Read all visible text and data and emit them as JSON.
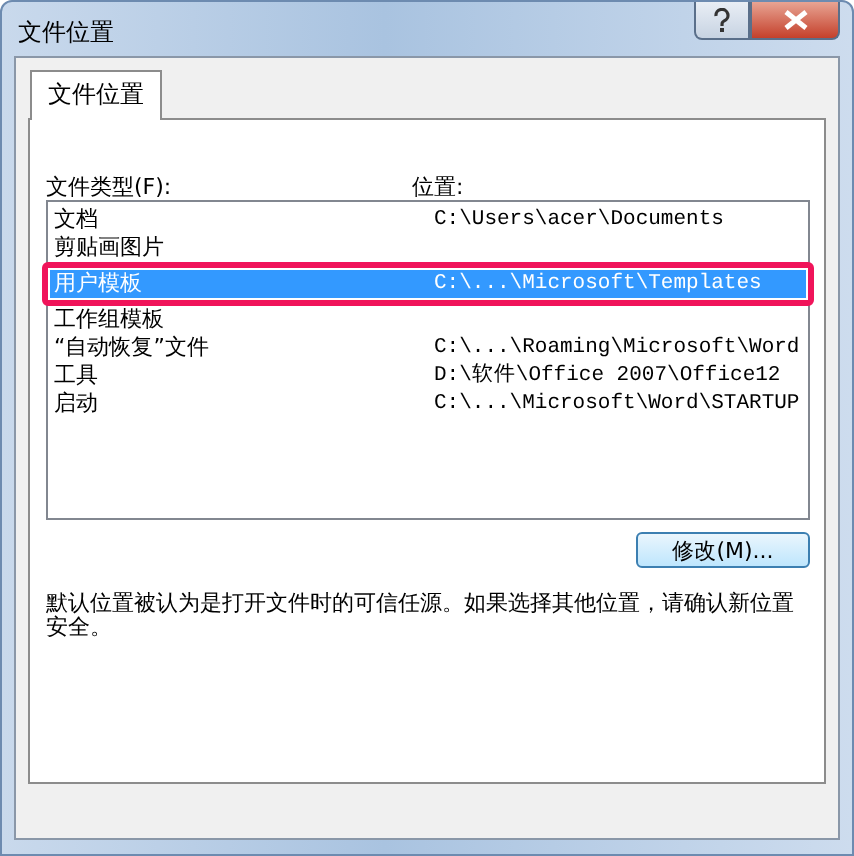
{
  "window": {
    "title": "文件位置"
  },
  "tabs": [
    {
      "label": "文件位置",
      "selected": true
    }
  ],
  "list": {
    "type_header": "文件类型(F):",
    "location_header": "位置:",
    "rows": [
      {
        "type": "文档",
        "location": "C:\\Users\\acer\\Documents",
        "selected": false,
        "outlined": false
      },
      {
        "type": "剪贴画图片",
        "selected": false,
        "outlined": false
      },
      {
        "type": "用户模板",
        "location": "C:\\...\\Microsoft\\Templates",
        "selected": true,
        "outlined": true
      },
      {
        "type": "工作组模板",
        "selected": false,
        "outlined": false
      },
      {
        "type": "“自动恢复”文件",
        "location": "C:\\...\\Roaming\\Microsoft\\Word",
        "selected": false,
        "outlined": false
      },
      {
        "type": "工具",
        "location": "D:\\软件\\Office 2007\\Office12",
        "selected": false,
        "outlined": false
      },
      {
        "type": "启动",
        "location": "C:\\...\\Microsoft\\Word\\STARTUP",
        "selected": false,
        "outlined": false
      }
    ]
  },
  "modify_button": "修改(M)...",
  "note": "默认位置被认为是打开文件时的可信任源。如果选择其他位置，请确认新位置安全。"
}
